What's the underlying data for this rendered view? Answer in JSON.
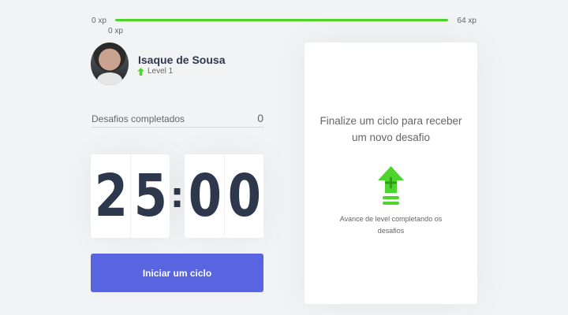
{
  "experience": {
    "min_label": "0 xp",
    "max_label": "64 xp",
    "current_label": "0 xp",
    "progress_fraction": 1.0
  },
  "profile": {
    "name": "Isaque de Sousa",
    "level_label": "Level 1"
  },
  "challenges": {
    "label": "Desafios completados",
    "count": "0"
  },
  "countdown": {
    "minute_left": "2",
    "minute_right": "5",
    "separator": ":",
    "second_left": "0",
    "second_right": "0"
  },
  "cycle_button": {
    "label": "Iniciar um ciclo"
  },
  "challenge_box": {
    "title": "Finalize um ciclo para receber um novo desafio",
    "hint": "Avance de level completando os desafios",
    "icon": "level-up-icon"
  },
  "colors": {
    "background": "#f2f3f5",
    "accent_blue": "#5965e0",
    "xp_green": "#4cd62b",
    "title_dark": "#2e384d"
  }
}
